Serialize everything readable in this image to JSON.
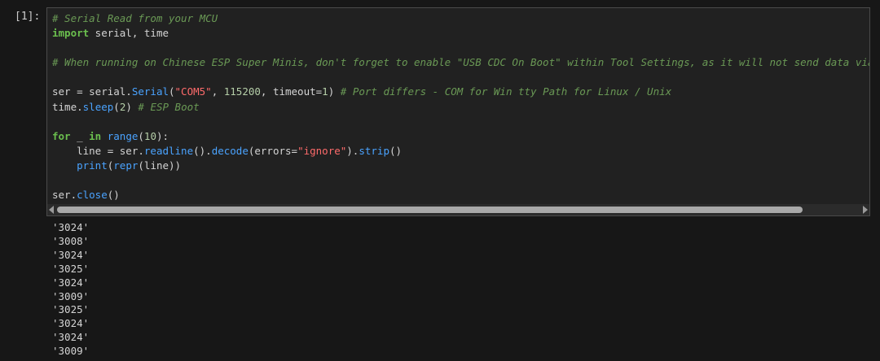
{
  "cell": {
    "prompt": "[1]:",
    "code_lines": [
      [
        {
          "t": "# Serial Read from your MCU",
          "c": "cm"
        }
      ],
      [
        {
          "t": "import",
          "c": "kw"
        },
        {
          "t": " serial, time"
        }
      ],
      [],
      [
        {
          "t": "# When running on Chinese ESP Super Minis, don't forget to enable \"USB CDC On Boot\" within Tool Settings, as it will not send data via Serial",
          "c": "cm"
        }
      ],
      [],
      [
        {
          "t": "ser = serial."
        },
        {
          "t": "Serial",
          "c": "fn"
        },
        {
          "t": "("
        },
        {
          "t": "\"COM5\"",
          "c": "str"
        },
        {
          "t": ", "
        },
        {
          "t": "115200",
          "c": "num"
        },
        {
          "t": ", timeout="
        },
        {
          "t": "1",
          "c": "num"
        },
        {
          "t": ") "
        },
        {
          "t": "# Port differs - COM for Win tty Path for Linux / Unix",
          "c": "cm"
        }
      ],
      [
        {
          "t": "time."
        },
        {
          "t": "sleep",
          "c": "fn"
        },
        {
          "t": "("
        },
        {
          "t": "2",
          "c": "num"
        },
        {
          "t": ") "
        },
        {
          "t": "# ESP Boot",
          "c": "cm"
        }
      ],
      [],
      [
        {
          "t": "for",
          "c": "kw"
        },
        {
          "t": " _ "
        },
        {
          "t": "in",
          "c": "kw"
        },
        {
          "t": " "
        },
        {
          "t": "range",
          "c": "fn"
        },
        {
          "t": "("
        },
        {
          "t": "10",
          "c": "num"
        },
        {
          "t": "):"
        }
      ],
      [
        {
          "t": "    line = ser."
        },
        {
          "t": "readline",
          "c": "fn"
        },
        {
          "t": "()."
        },
        {
          "t": "decode",
          "c": "fn"
        },
        {
          "t": "(errors="
        },
        {
          "t": "\"ignore\"",
          "c": "str"
        },
        {
          "t": ")."
        },
        {
          "t": "strip",
          "c": "fn"
        },
        {
          "t": "()"
        }
      ],
      [
        {
          "t": "    "
        },
        {
          "t": "print",
          "c": "fn"
        },
        {
          "t": "("
        },
        {
          "t": "repr",
          "c": "fn"
        },
        {
          "t": "(line))"
        }
      ],
      [],
      [
        {
          "t": "ser."
        },
        {
          "t": "close",
          "c": "fn"
        },
        {
          "t": "()"
        }
      ]
    ]
  },
  "output_lines": [
    "'3024'",
    "'3008'",
    "'3024'",
    "'3025'",
    "'3024'",
    "'3009'",
    "'3025'",
    "'3024'",
    "'3024'",
    "'3009'"
  ]
}
